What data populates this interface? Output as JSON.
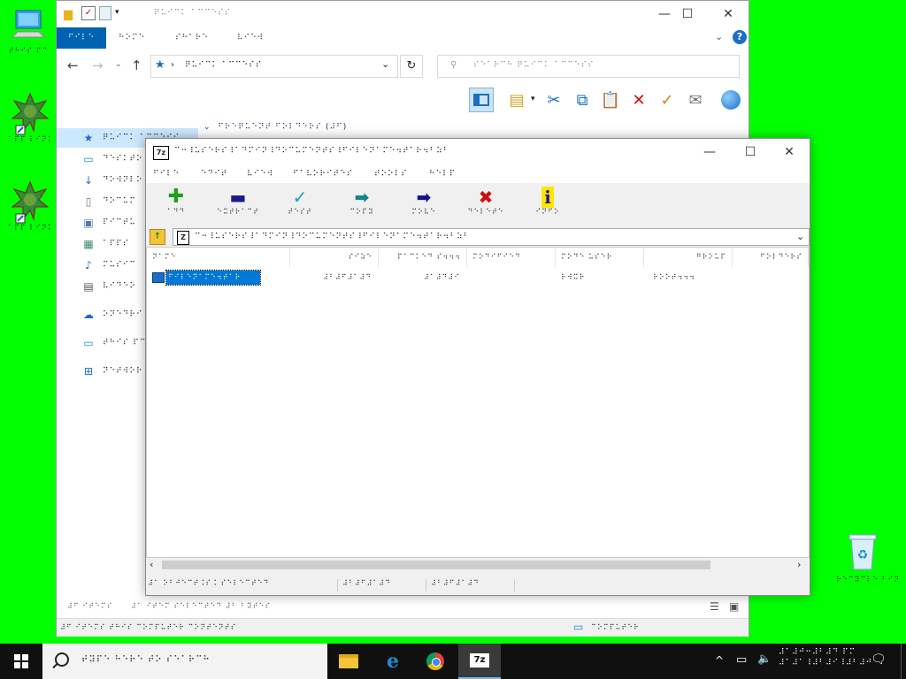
{
  "desktop": {
    "icons": [
      {
        "label": "⠞⠓⠊⠎ ⠏⠉"
      },
      {
        "label": "⠁⠏⠏ ⠇⠊⠝⠅"
      },
      {
        "label": "⠁⠏⠏ ⠇⠊⠝⠅"
      },
      {
        "label": "⠗⠑⠉⠽⠉⠇⠑ ⠃⠊⠝"
      }
    ]
  },
  "explorer": {
    "title": "⠟⠥⠊⠉⠅ ⠁⠉⠉⠑⠎⠎",
    "ribbon_tabs": [
      "⠋⠊⠇⠑",
      "⠓⠕⠍⠑",
      "⠎⠓⠁⠗⠑",
      "⠧⠊⠑⠺"
    ],
    "address": "⠟⠥⠊⠉⠅ ⠁⠉⠉⠑⠎⠎",
    "search_placeholder": "⠎⠑⠁⠗⠉⠓ ⠟⠥⠊⠉⠅ ⠁⠉⠉⠑⠎⠎",
    "section_header": "⠋⠗⠑⠟⠥⠑⠝⠞ ⠋⠕⠇⠙⠑⠗⠎ (⠼⠋)",
    "nav": [
      {
        "label": "⠟⠥⠊⠉⠅ ⠁⠉⠉⠑⠎⠎",
        "icon": "star-icon"
      },
      {
        "label": "⠙⠑⠎⠅⠞⠕",
        "icon": "desktop-icon"
      },
      {
        "label": "⠙⠕⠺⠝⠇⠕",
        "icon": "download-icon"
      },
      {
        "label": "⠙⠕⠉⠥⠍",
        "icon": "document-icon"
      },
      {
        "label": "⠏⠊⠉⠞⠥",
        "icon": "picture-icon"
      },
      {
        "label": "⠁⠏⠏⠎",
        "icon": "app-icon"
      },
      {
        "label": "⠍⠥⠎⠊⠉",
        "icon": "music-icon"
      },
      {
        "label": "⠧⠊⠙⠑⠕",
        "icon": "video-icon"
      },
      {
        "label": "⠕⠝⠑⠙⠗⠊",
        "icon": "cloud-icon"
      },
      {
        "label": "⠞⠓⠊⠎ ⠏⠉",
        "icon": "computer-icon"
      },
      {
        "label": "⠝⠑⠞⠺⠕⠗",
        "icon": "network-icon"
      }
    ],
    "status_left": "⠼⠋ ⠊⠞⠑⠍⠎",
    "status_mid": "⠼⠁ ⠊⠞⠑⠍ ⠎⠑⠇⠑⠉⠞⠑⠙ ⠼⠃ ⠃⠽⠞⠑⠎",
    "bottom_left": "⠼⠋ ⠊⠞⠑⠍⠎ ⠞⠓⠊⠎ ⠉⠕⠍⠏⠥⠞⠑⠗ ⠉⠕⠝⠞⠑⠝⠞⠎",
    "bottom_right": "⠉⠕⠍⠏⠥⠞⠑⠗"
  },
  "sevenzip": {
    "title": "⠉⠒⠸⠥⠎⠑⠗⠎⠸⠁⠙⠍⠊⠝⠸⠙⠕⠉⠥⠍⠑⠝⠞⠎⠸⠋⠊⠇⠑⠝⠁⠍⠑⠲⠞⠁⠗⠲⠃⠵⠃",
    "menu": [
      "⠋⠊⠇⠑",
      "⠑⠙⠊⠞",
      "⠧⠊⠑⠺",
      "⠋⠁⠧⠕⠗⠊⠞⠑⠎",
      "⠞⠕⠕⠇⠎",
      "⠓⠑⠇⠏"
    ],
    "toolbar": [
      {
        "label": "⠁⠙⠙",
        "icon": "add-icon",
        "color": "#1aa31a"
      },
      {
        "label": "⠑⠭⠞⠗⠁⠉⠞",
        "icon": "extract-icon",
        "color": "#1a1a8c"
      },
      {
        "label": "⠞⠑⠎⠞",
        "icon": "test-icon",
        "color": "#13a6b4"
      },
      {
        "label": "⠉⠕⠏⠽",
        "icon": "copy-icon",
        "color": "#15838a"
      },
      {
        "label": "⠍⠕⠧⠑",
        "icon": "move-icon",
        "color": "#14148a"
      },
      {
        "label": "⠙⠑⠇⠑⠞⠑",
        "icon": "delete-icon",
        "color": "#cc1010"
      },
      {
        "label": "⠊⠝⠋⠕",
        "icon": "info-icon",
        "color": "#c8a800"
      }
    ],
    "address": "⠉⠒⠸⠥⠎⠑⠗⠎⠸⠁⠙⠍⠊⠝⠸⠙⠕⠉⠥⠍⠑⠝⠞⠎⠸⠋⠊⠇⠑⠝⠁⠍⠑⠲⠞⠁⠗⠲⠃⠵⠃",
    "columns": [
      "⠝⠁⠍⠑",
      "⠎⠊⠵⠑",
      "⠏⠁⠉⠅⠑⠙ ⠎⠲⠲⠲",
      "⠍⠕⠙⠊⠋⠊⠑⠙",
      "⠍⠕⠙⠑ ⠥⠎⠑⠗",
      "⠛⠗⠕⠥⠏",
      "⠋⠕⠇⠙⠑⠗⠎"
    ],
    "row": {
      "name": "⠋⠊⠇⠑⠝⠁⠍⠑⠲⠞⠁⠗",
      "size": "⠼⠃⠼⠋⠼⠁⠼⠙",
      "packed": "⠼⠁⠼⠙⠼⠊",
      "mode": "⠗⠺⠭⠗",
      "user": "⠗⠕⠕⠞⠲⠲⠲"
    },
    "status_left": "⠼⠁ ⠕⠃⠚⠑⠉⠞⠨⠎⠨ ⠎⠑⠇⠑⠉⠞⠑⠙",
    "status_mid": "⠼⠃⠼⠋⠼⠁⠼⠙",
    "status_right": "⠼⠃⠼⠋⠼⠁⠼⠙"
  },
  "taskbar": {
    "search_placeholder": "⠞⠽⠏⠑ ⠓⠑⠗⠑ ⠞⠕ ⠎⠑⠁⠗⠉⠓",
    "clock_time": "⠼⠁⠼⠚⠒⠼⠃⠼⠙ ⠏⠍",
    "clock_date": "⠼⠁⠼⠁⠸⠼⠃⠼⠊⠸⠼⠃⠼⠚"
  },
  "colors": {
    "accent": "#0063b1",
    "desktop": "#00ff00",
    "taskbar": "#101010",
    "selection": "#0078d7"
  }
}
